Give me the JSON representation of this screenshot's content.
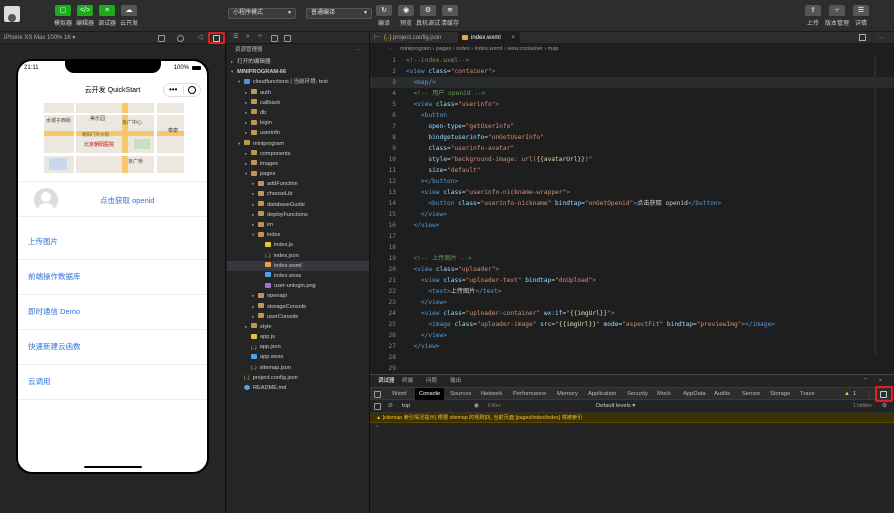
{
  "toolbar": {
    "buttons_left": [
      {
        "label": "模拟器",
        "glyph": "▢"
      },
      {
        "label": "编辑器",
        "glyph": "</>"
      },
      {
        "label": "调试器",
        "glyph": "≡"
      },
      {
        "label": "云开发",
        "glyph": "☁"
      }
    ],
    "mode_select": "小程序模式",
    "compile_select": "普通编译",
    "buttons_mid": [
      {
        "label": "编译",
        "glyph": "↻"
      },
      {
        "label": "预览",
        "glyph": "◉"
      },
      {
        "label": "真机调试",
        "glyph": "⚙"
      },
      {
        "label": "清缓存",
        "glyph": "≋"
      }
    ],
    "buttons_right": [
      {
        "label": "上传",
        "glyph": "⇪"
      },
      {
        "label": "版本管理",
        "glyph": "⑂"
      },
      {
        "label": "详情",
        "glyph": "☰"
      }
    ]
  },
  "simulator": {
    "device": "iPhone XS Max 100% 16 ▾",
    "status_time": "21:11",
    "status_battery": "100%",
    "title": "云开发 QuickStart",
    "map_labels": [
      "水城子西街",
      "美乐园",
      "京广中心",
      "泰康",
      "北京朝阳医院",
      "京广桥",
      "朝阳门外大街"
    ],
    "get_openid": "点击获取 openid",
    "items": [
      "上传图片",
      "前端操作数据库",
      "即时通信 Demo",
      "快速新建云函数",
      "云调用"
    ]
  },
  "explorer": {
    "title": "资源管理器",
    "open_editors": "打开的编辑器",
    "project": "MINIPROGRAM-66",
    "tree": [
      {
        "label": "cloudfunctions | 当前环境: test",
        "depth": 1,
        "type": "folder-b",
        "arrow": "▾"
      },
      {
        "label": "auth",
        "depth": 2,
        "type": "folder",
        "arrow": "▸"
      },
      {
        "label": "callback",
        "depth": 2,
        "type": "folder",
        "arrow": "▸"
      },
      {
        "label": "db",
        "depth": 2,
        "type": "folder",
        "arrow": "▸"
      },
      {
        "label": "login",
        "depth": 2,
        "type": "folder",
        "arrow": "▸"
      },
      {
        "label": "userinfo",
        "depth": 2,
        "type": "folder",
        "arrow": "▸"
      },
      {
        "label": "miniprogram",
        "depth": 1,
        "type": "folder",
        "arrow": "▾"
      },
      {
        "label": "components",
        "depth": 2,
        "type": "folder",
        "arrow": "▸"
      },
      {
        "label": "images",
        "depth": 2,
        "type": "folder",
        "arrow": "▸"
      },
      {
        "label": "pages",
        "depth": 2,
        "type": "folder",
        "arrow": "▾"
      },
      {
        "label": "addFunction",
        "depth": 3,
        "type": "folder",
        "arrow": "▸"
      },
      {
        "label": "chooseLib",
        "depth": 3,
        "type": "folder",
        "arrow": "▸"
      },
      {
        "label": "databaseGuide",
        "depth": 3,
        "type": "folder",
        "arrow": "▸"
      },
      {
        "label": "deployFunctions",
        "depth": 3,
        "type": "folder",
        "arrow": "▸"
      },
      {
        "label": "im",
        "depth": 3,
        "type": "folder",
        "arrow": "▸"
      },
      {
        "label": "index",
        "depth": 3,
        "type": "folder",
        "arrow": "▾"
      },
      {
        "label": "index.js",
        "depth": 4,
        "type": "js",
        "arrow": ""
      },
      {
        "label": "index.json",
        "depth": 4,
        "type": "json",
        "arrow": ""
      },
      {
        "label": "index.wxml",
        "depth": 4,
        "type": "wxml",
        "arrow": "",
        "selected": true
      },
      {
        "label": "index.wxss",
        "depth": 4,
        "type": "wxss",
        "arrow": ""
      },
      {
        "label": "user-unlogin.png",
        "depth": 4,
        "type": "png",
        "arrow": ""
      },
      {
        "label": "openapi",
        "depth": 3,
        "type": "folder",
        "arrow": "▸"
      },
      {
        "label": "storageConsole",
        "depth": 3,
        "type": "folder",
        "arrow": "▸"
      },
      {
        "label": "userConsole",
        "depth": 3,
        "type": "folder",
        "arrow": "▸"
      },
      {
        "label": "style",
        "depth": 2,
        "type": "folder",
        "arrow": "▸"
      },
      {
        "label": "app.js",
        "depth": 2,
        "type": "js",
        "arrow": ""
      },
      {
        "label": "app.json",
        "depth": 2,
        "type": "json",
        "arrow": ""
      },
      {
        "label": "app.wxss",
        "depth": 2,
        "type": "wxss",
        "arrow": ""
      },
      {
        "label": "sitemap.json",
        "depth": 2,
        "type": "json",
        "arrow": ""
      },
      {
        "label": "project.config.json",
        "depth": 1,
        "type": "json",
        "arrow": ""
      },
      {
        "label": "README.md",
        "depth": 1,
        "type": "md",
        "arrow": ""
      }
    ]
  },
  "editor": {
    "tabs": [
      "project.config.json",
      "index.wxml"
    ],
    "breadcrumb": "miniprogram › pages › index › index.wxml › view.container › map",
    "lines": [
      [
        [
          "t-cmt",
          "<!--index.wxml-->"
        ]
      ],
      [
        [
          "t-tag",
          "<view "
        ],
        [
          "t-attr",
          "class"
        ],
        [
          "t-txt",
          "="
        ],
        [
          "t-str",
          "\"container\""
        ],
        [
          "t-tag",
          ">"
        ]
      ],
      [
        [
          "t-tag",
          "  <map/>"
        ]
      ],
      [
        [
          "t-cmt",
          "  <!-- 用户 openid -->"
        ]
      ],
      [
        [
          "t-tag",
          "  <view "
        ],
        [
          "t-attr",
          "class"
        ],
        [
          "t-txt",
          "="
        ],
        [
          "t-str",
          "\"userinfo\""
        ],
        [
          "t-tag",
          ">"
        ]
      ],
      [
        [
          "t-tag",
          "    <button"
        ]
      ],
      [
        [
          "t-attr",
          "      open-type"
        ],
        [
          "t-txt",
          "="
        ],
        [
          "t-str",
          "\"getUserInfo\""
        ]
      ],
      [
        [
          "t-attr",
          "      bindgetuserinfo"
        ],
        [
          "t-txt",
          "="
        ],
        [
          "t-str",
          "\"onGetUserInfo\""
        ]
      ],
      [
        [
          "t-attr",
          "      class"
        ],
        [
          "t-txt",
          "="
        ],
        [
          "t-str",
          "\"userinfo-avatar\""
        ]
      ],
      [
        [
          "t-attr",
          "      style"
        ],
        [
          "t-txt",
          "="
        ],
        [
          "t-str",
          "\"background-image: url("
        ],
        [
          "t-brace",
          "{{avatarUrl}}"
        ],
        [
          "t-str",
          ")\""
        ]
      ],
      [
        [
          "t-attr",
          "      size"
        ],
        [
          "t-txt",
          "="
        ],
        [
          "t-str",
          "\"default\""
        ]
      ],
      [
        [
          "t-tag",
          "    ></button>"
        ]
      ],
      [
        [
          "t-tag",
          "    <view "
        ],
        [
          "t-attr",
          "class"
        ],
        [
          "t-txt",
          "="
        ],
        [
          "t-str",
          "\"userinfo-nickname-wrapper\""
        ],
        [
          "t-tag",
          ">"
        ]
      ],
      [
        [
          "t-tag",
          "      <button "
        ],
        [
          "t-attr",
          "class"
        ],
        [
          "t-txt",
          "="
        ],
        [
          "t-str",
          "\"userinfo-nickname\" "
        ],
        [
          "t-attr",
          "bindtap"
        ],
        [
          "t-txt",
          "="
        ],
        [
          "t-str",
          "\"onGetOpenid\""
        ],
        [
          "t-tag",
          ">"
        ],
        [
          "t-txt",
          "点击获取 openid"
        ],
        [
          "t-tag",
          "</button>"
        ]
      ],
      [
        [
          "t-tag",
          "    </view>"
        ]
      ],
      [
        [
          "t-tag",
          "  </view>"
        ]
      ],
      [
        [
          "t-txt",
          ""
        ]
      ],
      [
        [
          "t-txt",
          ""
        ]
      ],
      [
        [
          "t-cmt",
          "  <!-- 上传图片 -->"
        ]
      ],
      [
        [
          "t-tag",
          "  <view "
        ],
        [
          "t-attr",
          "class"
        ],
        [
          "t-txt",
          "="
        ],
        [
          "t-str",
          "\"uploader\""
        ],
        [
          "t-tag",
          ">"
        ]
      ],
      [
        [
          "t-tag",
          "    <view "
        ],
        [
          "t-attr",
          "class"
        ],
        [
          "t-txt",
          "="
        ],
        [
          "t-str",
          "\"uploader-text\" "
        ],
        [
          "t-attr",
          "bindtap"
        ],
        [
          "t-txt",
          "="
        ],
        [
          "t-str",
          "\"doUpload\""
        ],
        [
          "t-tag",
          ">"
        ]
      ],
      [
        [
          "t-tag",
          "      <text>"
        ],
        [
          "t-txt",
          "上传图片"
        ],
        [
          "t-tag",
          "</text>"
        ]
      ],
      [
        [
          "t-tag",
          "    </view>"
        ]
      ],
      [
        [
          "t-tag",
          "    <view "
        ],
        [
          "t-attr",
          "class"
        ],
        [
          "t-txt",
          "="
        ],
        [
          "t-str",
          "\"uploader-container\" "
        ],
        [
          "t-attr",
          "wx:if"
        ],
        [
          "t-txt",
          "="
        ],
        [
          "t-str",
          "\""
        ],
        [
          "t-brace",
          "{{imgUrl}}"
        ],
        [
          "t-str",
          "\""
        ],
        [
          "t-tag",
          ">"
        ]
      ],
      [
        [
          "t-tag",
          "      <image "
        ],
        [
          "t-attr",
          "class"
        ],
        [
          "t-txt",
          "="
        ],
        [
          "t-str",
          "\"uploader-image\" "
        ],
        [
          "t-attr",
          "src"
        ],
        [
          "t-txt",
          "="
        ],
        [
          "t-str",
          "\""
        ],
        [
          "t-brace",
          "{{imgUrl}}"
        ],
        [
          "t-str",
          "\" "
        ],
        [
          "t-attr",
          "mode"
        ],
        [
          "t-txt",
          "="
        ],
        [
          "t-str",
          "\"aspectFit\" "
        ],
        [
          "t-attr",
          "bindtap"
        ],
        [
          "t-txt",
          "="
        ],
        [
          "t-str",
          "\"previewImg\""
        ],
        [
          "t-tag",
          "></image>"
        ]
      ],
      [
        [
          "t-tag",
          "    </view>"
        ]
      ],
      [
        [
          "t-tag",
          "  </view>"
        ]
      ],
      [
        [
          "t-txt",
          ""
        ]
      ],
      [
        [
          "t-txt",
          ""
        ]
      ]
    ]
  },
  "devtools": {
    "top_tabs": [
      "调试器",
      "终端",
      "问题",
      "输出"
    ],
    "tabs": [
      "Wxml",
      "Console",
      "Sources",
      "Network",
      "Performance",
      "Memory",
      "Application",
      "Security",
      "Mock",
      "AppData",
      "Audits",
      "Sensor",
      "Storage",
      "Trace"
    ],
    "active_tab": "Console",
    "context": "top",
    "filter_placeholder": "Filter",
    "levels": "Default levels ▾",
    "hidden": "1 hidden",
    "warning": "[sitemap 索引情况提示] 根据 sitemap 的规则[0], 当前页面 [pages/index/index] 将被索引",
    "warn_count": "1"
  }
}
